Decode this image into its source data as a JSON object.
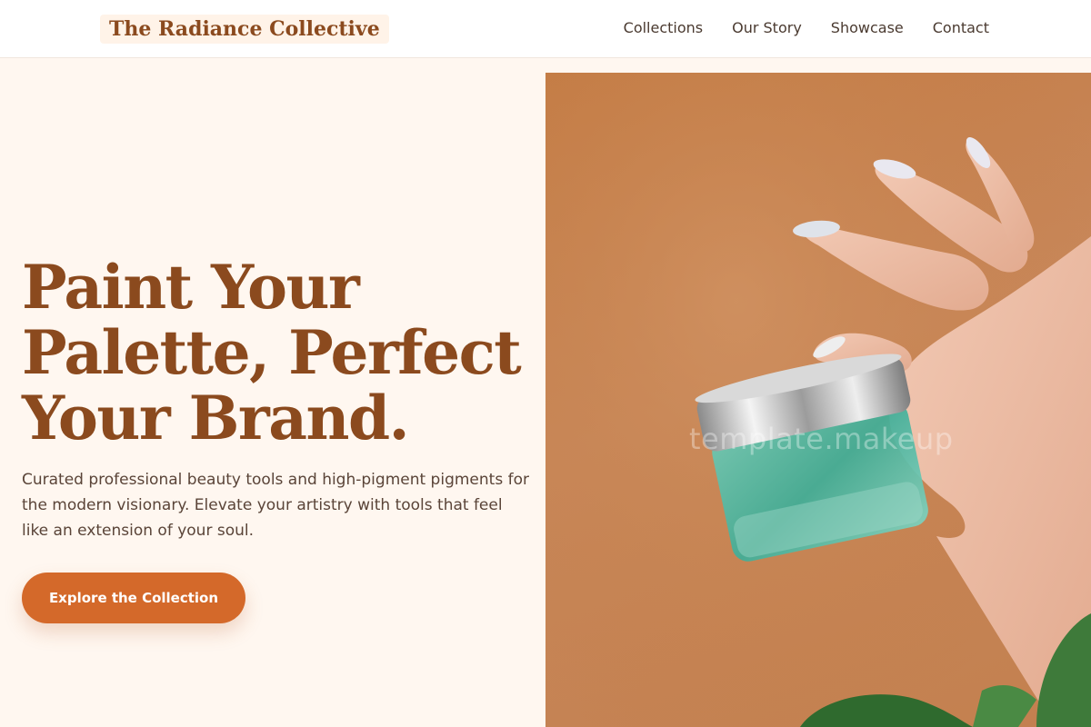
{
  "header": {
    "brand": "The Radiance Collective",
    "nav": [
      "Collections",
      "Our Story",
      "Showcase",
      "Contact"
    ]
  },
  "hero": {
    "title_lines": [
      "Paint Your",
      "Palette, Perfect",
      "Your Brand."
    ],
    "subtitle": "Curated professional beauty tools and high-pigment pigments for the modern visionary. Elevate your artistry with tools that feel like an extension of your soul.",
    "cta_label": "Explore the Collection",
    "image_watermark": "template.makeup"
  },
  "colors": {
    "background": "#fff7f0",
    "brand_text": "#8b4a1e",
    "accent": "#d4692a",
    "image_backdrop": "#c8875a",
    "jar_glass": "#4fb8a4"
  },
  "icons": {
    "hero_image": "hand-holding-cosmetic-jar-illustration"
  }
}
